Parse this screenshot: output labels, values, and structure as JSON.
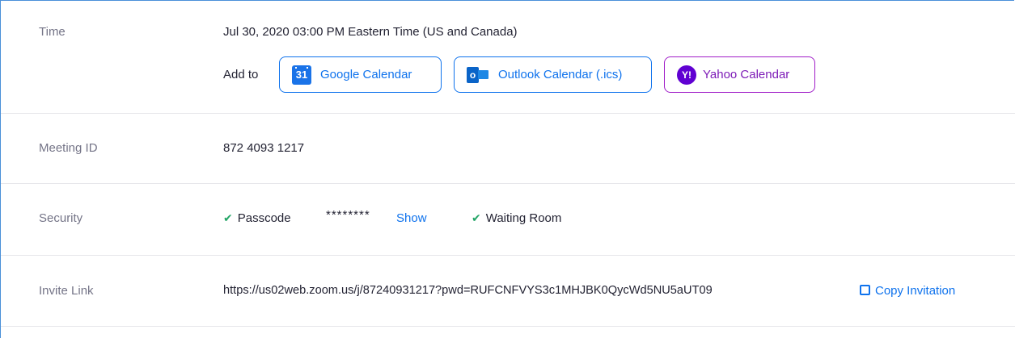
{
  "time": {
    "label": "Time",
    "value": "Jul 30, 2020 03:00 PM Eastern Time (US and Canada)",
    "add_to_label": "Add to",
    "calendars": [
      {
        "label": "Google Calendar",
        "icon": "google-calendar-icon",
        "icon_text": "31"
      },
      {
        "label": "Outlook Calendar (.ics)",
        "icon": "outlook-icon",
        "icon_text": "o"
      },
      {
        "label": "Yahoo Calendar",
        "icon": "yahoo-icon",
        "icon_text": "Y!"
      }
    ]
  },
  "meeting_id": {
    "label": "Meeting ID",
    "value": "872 4093 1217"
  },
  "security": {
    "label": "Security",
    "passcode_label": "Passcode",
    "passcode_masked": "********",
    "show_label": "Show",
    "waiting_room_label": "Waiting Room",
    "check_glyph": "✔"
  },
  "invite": {
    "label": "Invite Link",
    "url": "https://us02web.zoom.us/j/87240931217?pwd=RUFCNFVYS3c1MHJBK0QycWd5NU5aUT09",
    "copy_label": "Copy Invitation",
    "copy_glyph": "🡕"
  },
  "colors": {
    "accent": "#0e72ed",
    "yahoo": "#7d1bb7",
    "check": "#23a566",
    "label_gray": "#747487",
    "frame": "#4a90d9"
  }
}
